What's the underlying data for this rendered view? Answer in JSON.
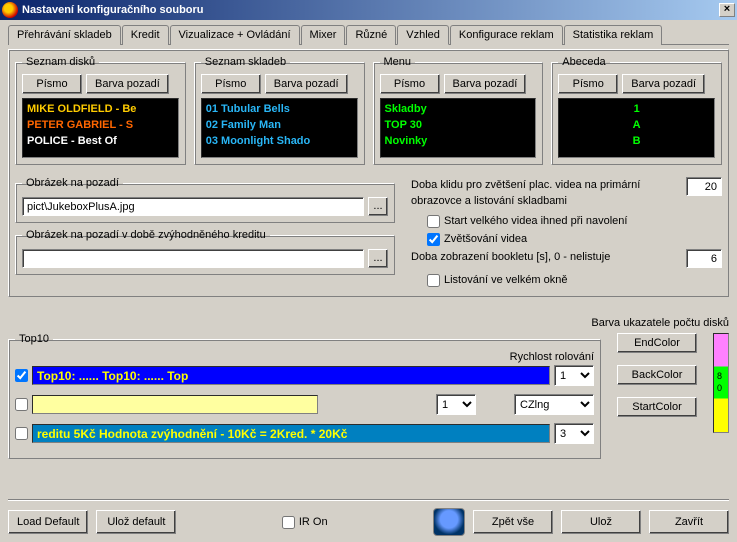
{
  "window": {
    "title": "Nastavení konfiguračního souboru"
  },
  "tabs": [
    "Přehrávání skladeb",
    "Kredit",
    "Vizualizace + Ovládání",
    "Mixer",
    "Různé",
    "Vzhled",
    "Konfigurace reklam",
    "Statistika reklam"
  ],
  "active_tab": 5,
  "panels": {
    "disks": {
      "legend": "Seznam disků",
      "font_btn": "Písmo",
      "bg_btn": "Barva pozadí",
      "lines": [
        "MIKE OLDFIELD - Be",
        "PETER GABRIEL - S",
        "POLICE - Best Of"
      ]
    },
    "tracks": {
      "legend": "Seznam skladeb",
      "font_btn": "Písmo",
      "bg_btn": "Barva pozadí",
      "lines": [
        "01 Tubular Bells",
        "02 Family Man",
        "03 Moonlight Shado"
      ]
    },
    "menu": {
      "legend": "Menu",
      "font_btn": "Písmo",
      "bg_btn": "Barva pozadí",
      "lines": [
        "Skladby",
        "TOP 30",
        "Novinky"
      ]
    },
    "abc": {
      "legend": "Abeceda",
      "font_btn": "Písmo",
      "bg_btn": "Barva pozadí",
      "lines": [
        "1",
        "A",
        "B"
      ]
    }
  },
  "bg_image": {
    "legend": "Obrázek na pozadí",
    "value": "pict\\JukeboxPlusA.jpg",
    "browse": "..."
  },
  "bg_image_credit": {
    "legend": "Obrázek na pozadí v době zvýhodněného kreditu",
    "value": "",
    "browse": "..."
  },
  "settings": {
    "idle": {
      "label": "Doba klidu pro zvětšení plac. videa na primární obrazovce a listování skladbami",
      "value": "20"
    },
    "start_video": {
      "label": "Start velkého videa ihned při navolení",
      "checked": false
    },
    "zoom_video": {
      "label": "Zvětšování videa",
      "checked": true
    },
    "booklet": {
      "label": "Doba zobrazení bookletu [s], 0 - nelistuje",
      "value": "6"
    },
    "big_window": {
      "label": "Listování ve velkém okně",
      "checked": false
    }
  },
  "top10": {
    "legend": "Top10",
    "scroll_label": "Rychlost rolování",
    "color_label": "Barva ukazatele počtu disků",
    "rows": [
      {
        "checked": true,
        "text": "Top10: ......          Top10: ......          Top",
        "speed": "1",
        "style": "blue"
      },
      {
        "checked": false,
        "text": "",
        "speed": "1",
        "style": "yellow"
      },
      {
        "checked": false,
        "text": "reditu 5Kč   Hodnota zvýhodnění - 10Kč = 2Kred. * 20Kč",
        "speed": "3",
        "style": "teal"
      }
    ],
    "lang_select": "CZlng",
    "end_btn": "EndColor",
    "back_btn": "BackColor",
    "start_btn": "StartColor",
    "grad_labels": [
      "8",
      "0"
    ]
  },
  "bottom": {
    "load_default": "Load Default",
    "save_default": "Ulož default",
    "ir_on": "IR On",
    "back_all": "Zpět vše",
    "save": "Ulož",
    "close": "Zavřít"
  }
}
